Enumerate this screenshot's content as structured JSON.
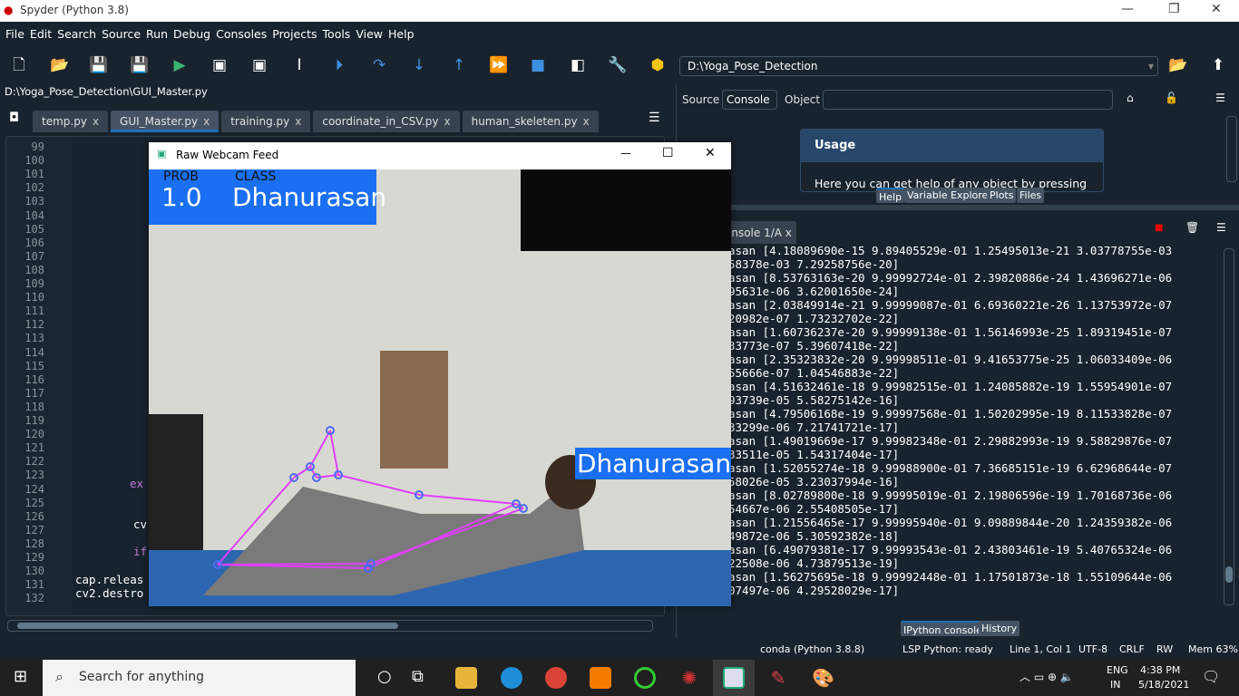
{
  "window": {
    "title": "Spyder (Python 3.8)"
  },
  "menu": [
    "File",
    "Edit",
    "Search",
    "Source",
    "Run",
    "Debug",
    "Consoles",
    "Projects",
    "Tools",
    "View",
    "Help"
  ],
  "toolbar": {
    "working_dir": "D:\\Yoga_Pose_Detection"
  },
  "editor": {
    "path": "D:\\Yoga_Pose_Detection\\GUI_Master.py",
    "tabs": [
      {
        "label": "temp.py"
      },
      {
        "label": "GUI_Master.py",
        "active": true
      },
      {
        "label": "training.py"
      },
      {
        "label": "coordinate_in_CSV.py"
      },
      {
        "label": "human_skeleten.py"
      }
    ],
    "close_glyph": "x",
    "line_numbers": [
      "99",
      "100",
      "101",
      "102",
      "103",
      "104",
      "105",
      "106",
      "107",
      "108",
      "109",
      "110",
      "111",
      "112",
      "113",
      "114",
      "115",
      "116",
      "117",
      "118",
      "119",
      "120",
      "121",
      "122",
      "123",
      "124",
      "125",
      "126",
      "127",
      "128",
      "129",
      "130",
      "131",
      "132"
    ],
    "code_fragments": {
      "l124": "ex",
      "l127": "cv",
      "l129": "if",
      "l131": "cap.releas",
      "l132": "cv2.destro"
    }
  },
  "help": {
    "source_label": "Source",
    "source_value": "Console",
    "object_label": "Object",
    "object_value": "",
    "usage_title": "Usage",
    "usage_text": "Here you can get help of any object by pressing",
    "tabs": [
      "Help",
      "Variable Explorer",
      "Plots",
      "Files"
    ]
  },
  "console": {
    "tab_label": "onsole 1/A",
    "lines": [
      "asan [4.18089690e-15 9.89405529e-01 1.25495013e-21 3.03778755e-03",
      "58378e-03 7.29258756e-20]",
      "asan [8.53763163e-20 9.99992724e-01 2.39820886e-24 1.43696271e-06",
      "95631e-06 3.62001650e-24]",
      "asan [2.03849914e-21 9.99999087e-01 6.69360221e-26 1.13753972e-07",
      "20982e-07 1.73232702e-22]",
      "asan [1.60736237e-20 9.99999138e-01 1.56146993e-25 1.89319451e-07",
      "33773e-07 5.39607418e-22]",
      "asan [2.35323832e-20 9.99998511e-01 9.41653775e-25 1.06033409e-06",
      "55666e-07 1.04546883e-22]",
      "asan [4.51632461e-18 9.99982515e-01 1.24085882e-19 1.55954901e-07",
      "93739e-05 5.58275142e-16]",
      "asan [4.79506168e-19 9.99997568e-01 1.50202995e-19 8.11533828e-07",
      "33299e-06 7.21741721e-17]",
      "asan [1.49019669e-17 9.99982348e-01 2.29882993e-19 9.58829876e-07",
      "33511e-05 1.54317404e-17]",
      "asan [1.52055274e-18 9.99988900e-01 7.36685151e-19 6.62968644e-07",
      "58026e-05 3.23037994e-16]",
      "asan [8.02789800e-18 9.99995019e-01 2.19806596e-19 1.70168736e-06",
      "54667e-06 2.55408505e-17]",
      "asan [1.21556465e-17 9.99995940e-01 9.09889844e-20 1.24359382e-06",
      "49872e-06 5.30592382e-18]",
      "asan [6.49079381e-17 9.99993543e-01 2.43803461e-19 5.40765324e-06",
      "22508e-06 4.73879513e-19]",
      "asan [1.56275695e-18 9.99992448e-01 1.17501873e-18 1.55109644e-06",
      "07497e-06 4.29528029e-17]"
    ],
    "bottom_tabs": [
      "IPython console",
      "History"
    ]
  },
  "status": {
    "env": "conda (Python 3.8.8)",
    "lsp": "LSP Python: ready",
    "pos": "Line 1, Col 1",
    "enc": "UTF-8",
    "eol": "CRLF",
    "perm": "RW",
    "mem": "Mem 63%"
  },
  "webcam": {
    "title": "Raw Webcam Feed",
    "prob_label": "PROB",
    "class_label": "CLASS",
    "prob_value": "1.0",
    "class_value": "Dhanurasan",
    "face_label": "Dhanurasan",
    "label_color": "#1a6ff2",
    "skeleton_color": "#e040fb"
  },
  "taskbar": {
    "search_placeholder": "Search for anything",
    "lang": "ENG",
    "region": "IN",
    "time": "4:38 PM",
    "date": "5/18/2021"
  }
}
